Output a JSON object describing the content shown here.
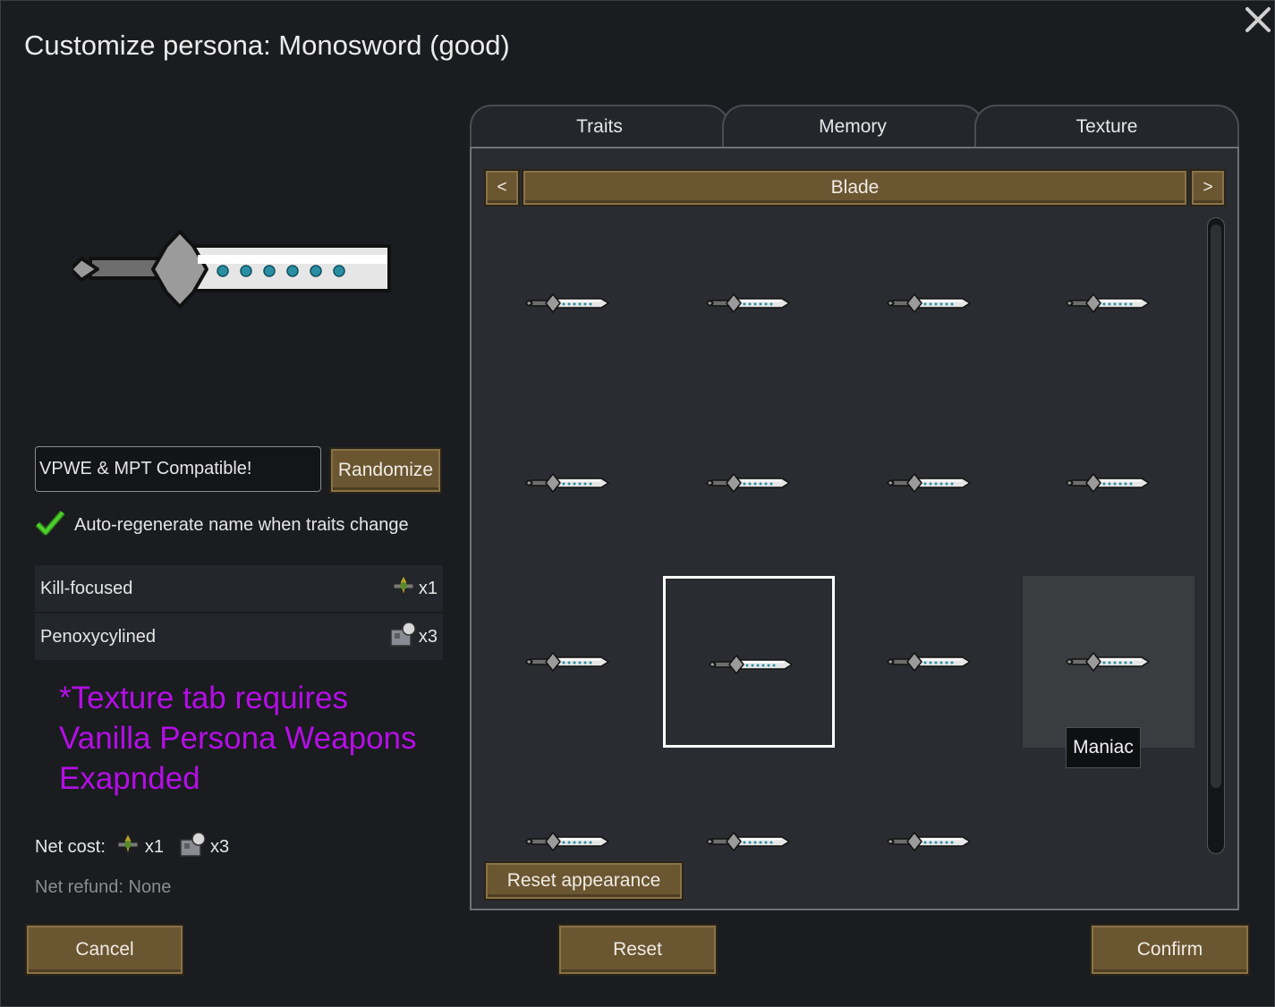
{
  "window": {
    "title": "Customize persona: Monosword (good)",
    "close_icon": "close-x-icon"
  },
  "name_field": {
    "value": "VPWE & MPT Compatible!",
    "randomize_label": "Randomize"
  },
  "auto_regen": {
    "checked": true,
    "label": "Auto-regenerate name when traits change"
  },
  "traits": [
    {
      "name": "Kill-focused",
      "cost_icon": "weapon-trait-icon",
      "cost": "x1"
    },
    {
      "name": "Penoxycylined",
      "cost_icon": "neural-chip-icon",
      "cost": "x3"
    }
  ],
  "note": "*Texture tab requires Vanilla Persona Weapons Exapnded",
  "net_cost": {
    "label": "Net cost:",
    "items": [
      {
        "icon": "weapon-trait-icon",
        "value": "x1"
      },
      {
        "icon": "neural-chip-icon",
        "value": "x3"
      }
    ]
  },
  "net_refund": "Net refund: None",
  "tabs": [
    {
      "label": "Traits",
      "active": false
    },
    {
      "label": "Memory",
      "active": false
    },
    {
      "label": "Texture",
      "active": true
    }
  ],
  "texture": {
    "category": "Blade",
    "prev_label": "<",
    "next_label": ">",
    "selected_index": 9,
    "hovered_index": 11,
    "tooltip": "Maniac",
    "reset_appearance_label": "Reset appearance",
    "blade_count": 15
  },
  "footer": {
    "cancel_label": "Cancel",
    "reset_label": "Reset",
    "confirm_label": "Confirm"
  },
  "colors": {
    "button_brown": "#6b5632",
    "note_purple": "#b50ee6",
    "blade_dots": "#2a8ea3"
  }
}
